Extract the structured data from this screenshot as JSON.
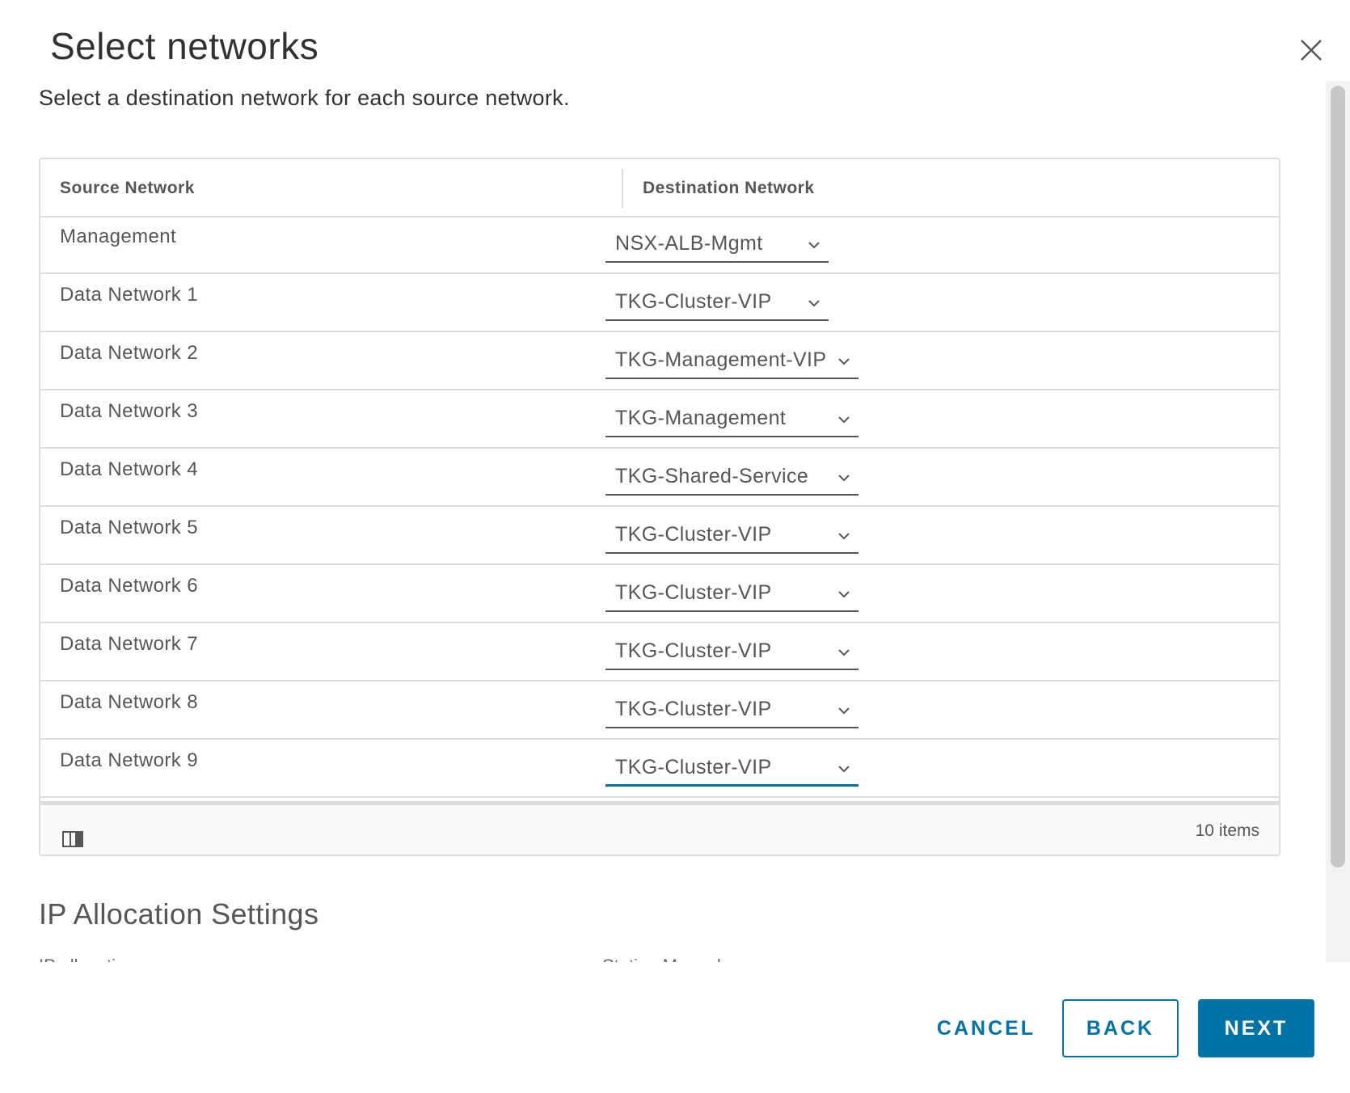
{
  "dialog": {
    "title": "Select networks",
    "description": "Select a destination network for each source network."
  },
  "grid": {
    "columns": [
      "Source Network",
      "Destination Network"
    ],
    "rows": [
      {
        "source": "Management",
        "destination": "NSX-ALB-Mgmt"
      },
      {
        "source": "Data Network 1",
        "destination": "TKG-Cluster-VIP"
      },
      {
        "source": "Data Network 2",
        "destination": "TKG-Management-VIP"
      },
      {
        "source": "Data Network 3",
        "destination": "TKG-Management"
      },
      {
        "source": "Data Network 4",
        "destination": "TKG-Shared-Service"
      },
      {
        "source": "Data Network 5",
        "destination": "TKG-Cluster-VIP"
      },
      {
        "source": "Data Network 6",
        "destination": "TKG-Cluster-VIP"
      },
      {
        "source": "Data Network 7",
        "destination": "TKG-Cluster-VIP"
      },
      {
        "source": "Data Network 8",
        "destination": "TKG-Cluster-VIP"
      },
      {
        "source": "Data Network 9",
        "destination": "TKG-Cluster-VIP"
      }
    ],
    "item_count": "10 items"
  },
  "ip_allocation": {
    "title": "IP Allocation Settings",
    "cut_label_1": "IP allocation",
    "cut_label_2": "Static - Manual"
  },
  "footer": {
    "cancel_label": "CANCEL",
    "back_label": "BACK",
    "next_label": "NEXT"
  },
  "colors": {
    "accent": "#0072a3",
    "text": "#313131",
    "muted_text": "#565656",
    "border": "#dcdcdc"
  },
  "icons": {
    "close": "close-icon",
    "caret": "chevron-down-icon",
    "column_toggle": "column-toggle-icon"
  }
}
